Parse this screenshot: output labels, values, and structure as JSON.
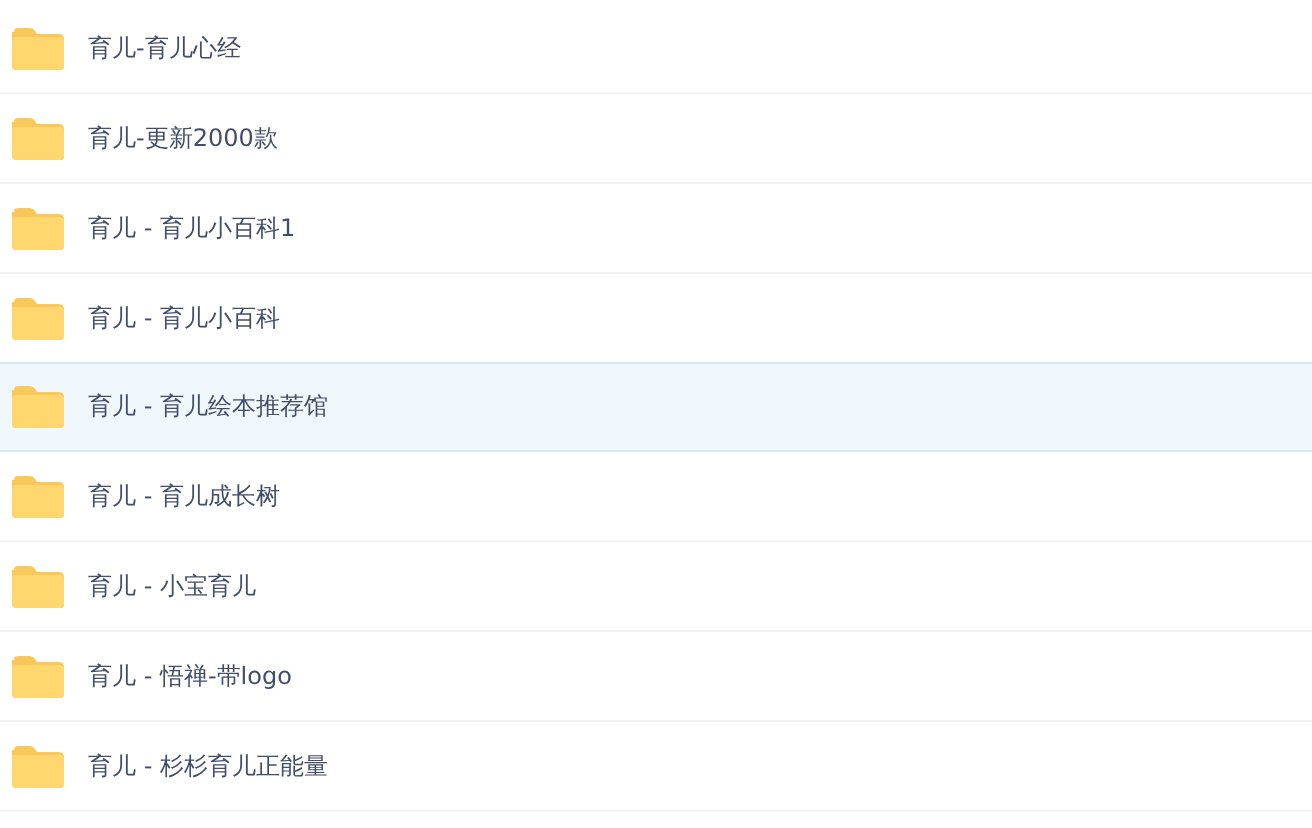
{
  "files": [
    {
      "name": "育儿-育儿心经",
      "selected": false
    },
    {
      "name": "育儿-更新2000款",
      "selected": false
    },
    {
      "name": "育儿 - 育儿小百科1",
      "selected": false
    },
    {
      "name": "育儿 - 育儿小百科",
      "selected": false
    },
    {
      "name": "育儿 - 育儿绘本推荐馆",
      "selected": true
    },
    {
      "name": "育儿 - 育儿成长树",
      "selected": false
    },
    {
      "name": "育儿 - 小宝育儿",
      "selected": false
    },
    {
      "name": "育儿 - 悟禅-带logo",
      "selected": false
    },
    {
      "name": "育儿 - 杉杉育儿正能量",
      "selected": false
    }
  ]
}
